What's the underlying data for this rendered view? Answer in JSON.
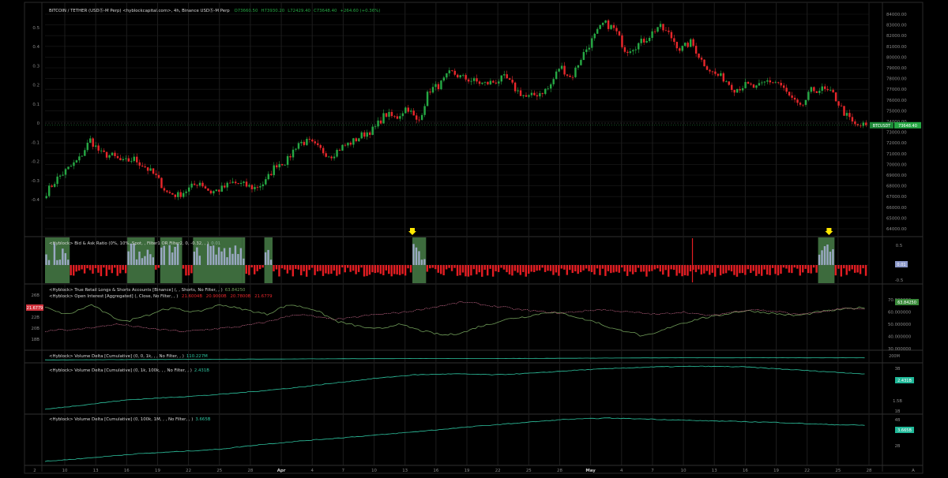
{
  "colors": {
    "background": "#000000",
    "up": "#26a844",
    "down": "#e8272b",
    "grid": "#1d1d1d",
    "text": "#8a8a8a",
    "green_fill": "#3d6b3d",
    "bid_bar": "#9aa8c2",
    "ask_bar": "#e41d22",
    "long_short": "#6f9b58",
    "oi": "#b0b6d9",
    "vd": "#2ec4a0",
    "marker": "#ffe800"
  },
  "header": {
    "title": "BITCOIN / TETHER (USDⓈ-M Perp) <hyblockcapital.com>, 4h, Binance USDⓈ-M Perp",
    "ohlc": [
      {
        "k": "O",
        "v": "73660.50",
        "color": "#26a844"
      },
      {
        "k": "H",
        "v": "73930.20",
        "color": "#26a844"
      },
      {
        "k": "L",
        "v": "72429.40",
        "color": "#26a844"
      },
      {
        "k": "C",
        "v": "73648.40",
        "color": "#26a844"
      },
      {
        "k": "",
        "v": "+264.60 (+0.36%)",
        "color": "#26a844"
      }
    ]
  },
  "price_panel": {
    "right_ticks": [
      "84000.00",
      "83000.00",
      "82000.00",
      "81000.00",
      "80000.00",
      "79000.00",
      "78000.00",
      "77000.00",
      "76000.00",
      "75000.00",
      "74000.00",
      "73000.00",
      "72000.00",
      "71000.00",
      "70000.00",
      "69000.00",
      "68000.00",
      "67000.00",
      "66000.00",
      "65000.00",
      "64000.00"
    ],
    "left_ticks": [
      "0.5",
      "0.4",
      "0.3",
      "0.2",
      "0.1",
      "0",
      "-0.1",
      "-0.2",
      "-0.3",
      "-0.4"
    ],
    "price_tag": "73648.40",
    "symbol_tag": "BTCUSDT"
  },
  "bidask_panel": {
    "legend": "<Hyblock> Bid & Ask Ratio (0%, 10%, Spot, , Filter1 OR Filter2, 0, -0.32, , )",
    "legend_value": "0.01",
    "right_ticks": [
      "0.5",
      "0",
      "-0.5"
    ],
    "value_tag": "0.01"
  },
  "ls_panel": {
    "legend1": "<Hyblock> True Retail Longs & Shorts Accounts [Binance] (, , Shorts, No Filter, , )",
    "legend1_value": "63.84250",
    "legend2": "<Hyblock> Open Interest [Aggregated] (, Close, No Filter, , )",
    "legend2_values": [
      "21.6004B",
      "20.9000B",
      "20.7800B",
      "21.6779"
    ],
    "right_ticks": [
      "70.000000",
      "60.000000",
      "50.000000",
      "40.000000",
      "30.000000"
    ],
    "left_ticks": [
      "26B",
      "24B",
      "22B",
      "20B",
      "18B"
    ],
    "left_tag": "21.6779",
    "right_tag": "63.84250"
  },
  "vd1_panel": {
    "legend": "<Hyblock> Volume Delta [Cumulative] (0, 0, 1k, , , No Filter, , )",
    "legend_value": "110.227M",
    "right_ticks": [
      "200M",
      "100M"
    ]
  },
  "vd2_panel": {
    "legend": "<Hyblock> Volume Delta [Cumulative] (0, 1k, 100k, , , No Filter, , )",
    "legend_value": "2.431B",
    "right_ticks": [
      "3B",
      "2B",
      "1.5B",
      "1B"
    ],
    "value_tag": "2.431B"
  },
  "vd3_panel": {
    "legend": "<Hyblock> Volume Delta [Cumulative] (0, 100k, 1M, , , No Filter, , )",
    "legend_value": "3.665B",
    "right_ticks": [
      "4B",
      "2B"
    ],
    "value_tag": "3.665B"
  },
  "x_axis": {
    "labels": [
      "10",
      "13",
      "16",
      "19",
      "22",
      "25",
      "28",
      "Apr",
      "4",
      "7",
      "10",
      "13",
      "16",
      "19",
      "22",
      "25",
      "28",
      "May",
      "4",
      "7",
      "10",
      "13",
      "16",
      "19",
      "22",
      "25",
      "28"
    ],
    "footer_left": "2",
    "footer_right": "A"
  },
  "chart_data": {
    "type": "candlestick",
    "timeframe": "4h",
    "x_start_label": "10",
    "x_end_label": "28",
    "close_path_approx": [
      67400,
      68700,
      69600,
      70500,
      72300,
      71000,
      70800,
      70200,
      70500,
      69800,
      68900,
      67400,
      67100,
      67700,
      68400,
      67400,
      67700,
      68300,
      68100,
      67800,
      68300,
      70000,
      70300,
      72000,
      72100,
      71400,
      70800,
      71600,
      72100,
      72800,
      73300,
      74700,
      74300,
      75400,
      73800,
      76900,
      77400,
      78600,
      78100,
      77800,
      77500,
      77700,
      78100,
      76900,
      76200,
      76600,
      77100,
      79200,
      78000,
      80100,
      81700,
      83200,
      82600,
      80600,
      81100,
      81800,
      82900,
      82100,
      80700,
      81400,
      79600,
      78500,
      78000,
      77000,
      77400,
      77100,
      77800,
      77600,
      76300,
      75200,
      76900,
      77000,
      76500,
      74800,
      73600,
      73648
    ],
    "bid_ask_green_zones_approx_index": [
      [
        0,
        9
      ],
      [
        30,
        40
      ],
      [
        42,
        50
      ],
      [
        54,
        72
      ],
      [
        72,
        73
      ],
      [
        80,
        83
      ],
      [
        134,
        139
      ],
      [
        282,
        288
      ]
    ],
    "markers": [
      "13",
      "28"
    ]
  }
}
